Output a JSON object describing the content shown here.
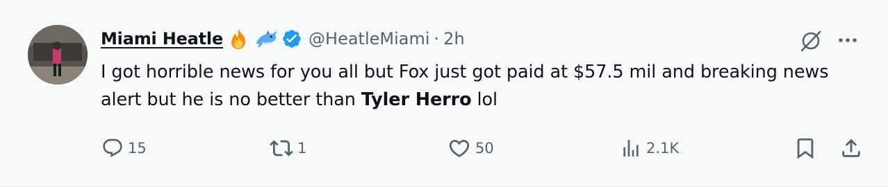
{
  "author": {
    "display_name": "Miami Heatle",
    "handle": "@HeatleMiami",
    "separator": "·",
    "time": "2h",
    "badges": [
      "fire-emoji",
      "dolphin-emoji",
      "verified-badge"
    ]
  },
  "tweet": {
    "text_before": "I got horrible news for you all but Fox just got paid at $57.5 mil and breaking news alert but he is no better than ",
    "text_bold": "Tyler Herro",
    "text_after": " lol"
  },
  "actions": {
    "replies": "15",
    "retweets": "1",
    "likes": "50",
    "views": "2.1K"
  },
  "icons": {
    "reply": "reply-icon",
    "retweet": "retweet-icon",
    "like": "heart-icon",
    "views": "views-icon",
    "bookmark": "bookmark-icon",
    "share": "share-icon",
    "grok": "grok-icon",
    "more": "more-icon"
  },
  "colors": {
    "text": "#0f1419",
    "secondary": "#536471",
    "verified": "#1d9bf0",
    "background": "#f7f9f9"
  }
}
